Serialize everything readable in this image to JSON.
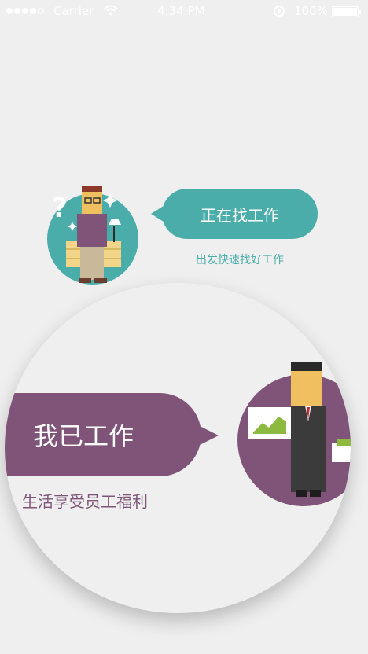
{
  "status_bar": {
    "carrier": "Carrier",
    "time": "4:34 PM",
    "battery": "100%"
  },
  "options": {
    "seeking": {
      "title": "正在找工作",
      "subtitle": "出发快速找好工作",
      "color": "#4aada9"
    },
    "employed": {
      "title": "我已工作",
      "subtitle": "生活享受员工福利",
      "color": "#7f5478"
    }
  },
  "icons": [
    "signal-dots-icon",
    "wifi-icon",
    "lock-rotation-icon",
    "battery-icon"
  ]
}
